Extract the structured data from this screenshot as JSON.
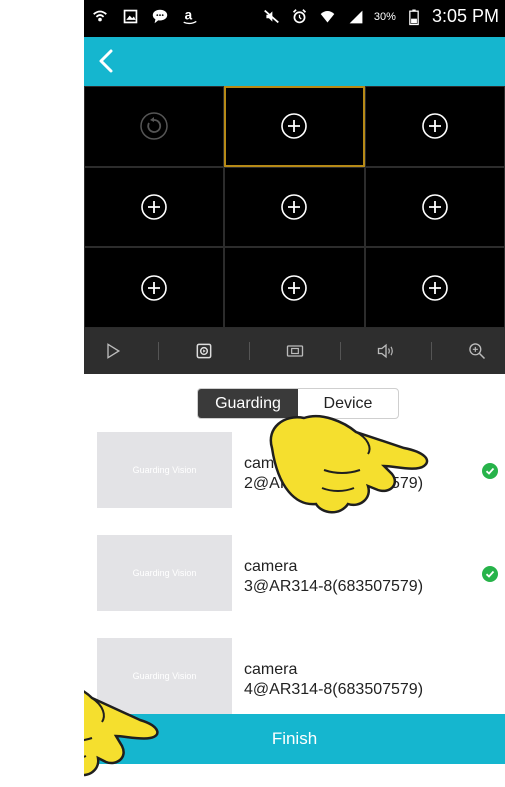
{
  "statusbar": {
    "battery": "30%",
    "time": "3:05 PM"
  },
  "tabs": [
    {
      "label": "Guarding",
      "active": true
    },
    {
      "label": "Device",
      "active": false
    }
  ],
  "devices": [
    {
      "thumb_text": "Guarding Vision",
      "name_line1": "camera",
      "name_line2": "2@AR314-8(683507579)",
      "checked": true
    },
    {
      "thumb_text": "Guarding Vision",
      "name_line1": "camera",
      "name_line2": "3@AR314-8(683507579)",
      "checked": true
    },
    {
      "thumb_text": "Guarding Vision",
      "name_line1": "camera",
      "name_line2": "4@AR314-8(683507579)",
      "checked": false
    }
  ],
  "finish_label": "Finish",
  "colors": {
    "accent": "#15b6cf",
    "check": "#27b34a",
    "selected_border": "#b78a17"
  },
  "icons": {
    "grid_cells": [
      "refresh-icon",
      "add-icon",
      "add-icon",
      "add-icon",
      "add-icon",
      "add-icon",
      "add-icon",
      "add-icon",
      "add-icon"
    ],
    "toolbar": [
      "play-icon",
      "record-icon",
      "capture-icon",
      "sound-icon",
      "zoom-icon"
    ]
  }
}
